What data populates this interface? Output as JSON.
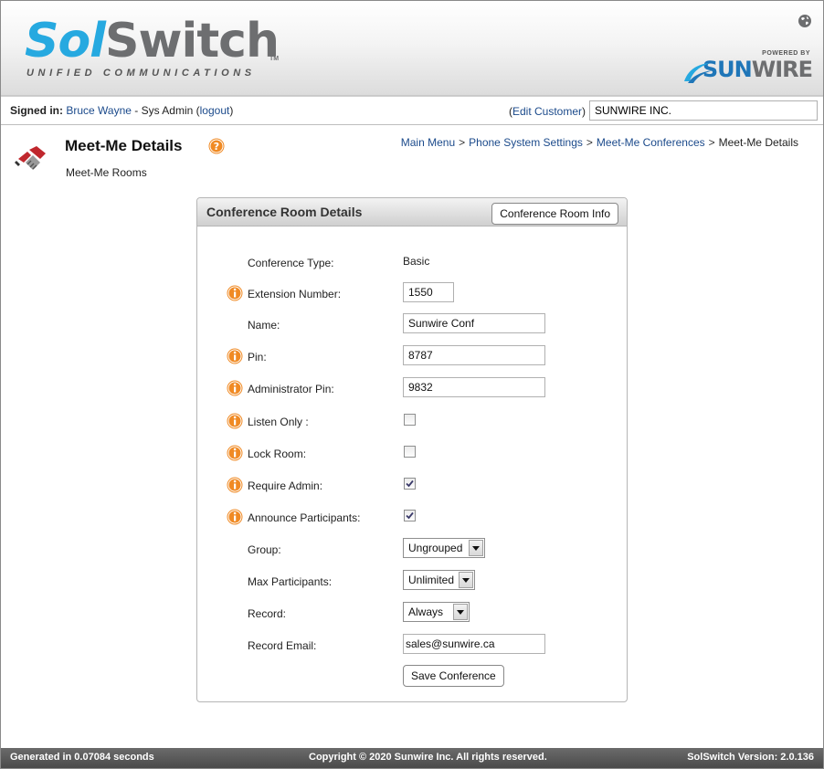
{
  "header": {
    "logo_sol": "Sol",
    "logo_switch": "Switch",
    "logo_tm": "TM",
    "logo_subtitle": "UNIFIED COMMUNICATIONS",
    "powered_by": "POWERED BY",
    "sunwire_sun": "SUN",
    "sunwire_wire": "WIRE"
  },
  "userbar": {
    "signed_label": "Signed in:",
    "user_name": "Bruce Wayne",
    "role": " - Sys Admin (",
    "logout": "logout",
    "close_paren": ")",
    "edit_open": "(",
    "edit_customer": "Edit Customer",
    "edit_close": ")",
    "customer_value": "SUNWIRE INC."
  },
  "page": {
    "title": "Meet-Me Details",
    "subtitle": "Meet-Me Rooms",
    "breadcrumb": [
      "Main Menu",
      "Phone System Settings",
      "Meet-Me Conferences",
      "Meet-Me Details"
    ],
    "breadcrumb_sep": ">"
  },
  "panel": {
    "title": "Conference Room Details",
    "info_button": "Conference Room Info",
    "fields": {
      "conference_type": {
        "label": "Conference Type:",
        "value": "Basic"
      },
      "extension": {
        "label": "Extension Number:",
        "value": "1550"
      },
      "name": {
        "label": "Name:",
        "value": "Sunwire Conf"
      },
      "pin": {
        "label": "Pin:",
        "value": "8787"
      },
      "admin_pin": {
        "label": "Administrator Pin:",
        "value": "9832"
      },
      "listen_only": {
        "label": "Listen Only :",
        "checked": false
      },
      "lock_room": {
        "label": "Lock Room:",
        "checked": false
      },
      "require_admin": {
        "label": "Require Admin:",
        "checked": true
      },
      "announce": {
        "label": "Announce Participants:",
        "checked": true
      },
      "group": {
        "label": "Group:",
        "value": "Ungrouped"
      },
      "max_participants": {
        "label": "Max Participants:",
        "value": "Unlimited"
      },
      "record": {
        "label": "Record:",
        "value": "Always"
      },
      "record_email": {
        "label": "Record Email:",
        "value": "sales@sunwire.ca"
      }
    },
    "save_button": "Save Conference"
  },
  "footer": {
    "generated": "Generated in 0.07084 seconds",
    "copyright": "Copyright © 2020 Sunwire Inc. All rights reserved.",
    "version": "SolSwitch Version: 2.0.136"
  },
  "colors": {
    "brand_blue": "#26a9e0",
    "brand_gray": "#6d6e70",
    "link": "#1b4a8b",
    "info_orange": "#f08a24"
  },
  "icons": [
    "globe-icon",
    "meet-me-icon",
    "help-icon",
    "info-icon",
    "dropdown-arrow-icon"
  ]
}
